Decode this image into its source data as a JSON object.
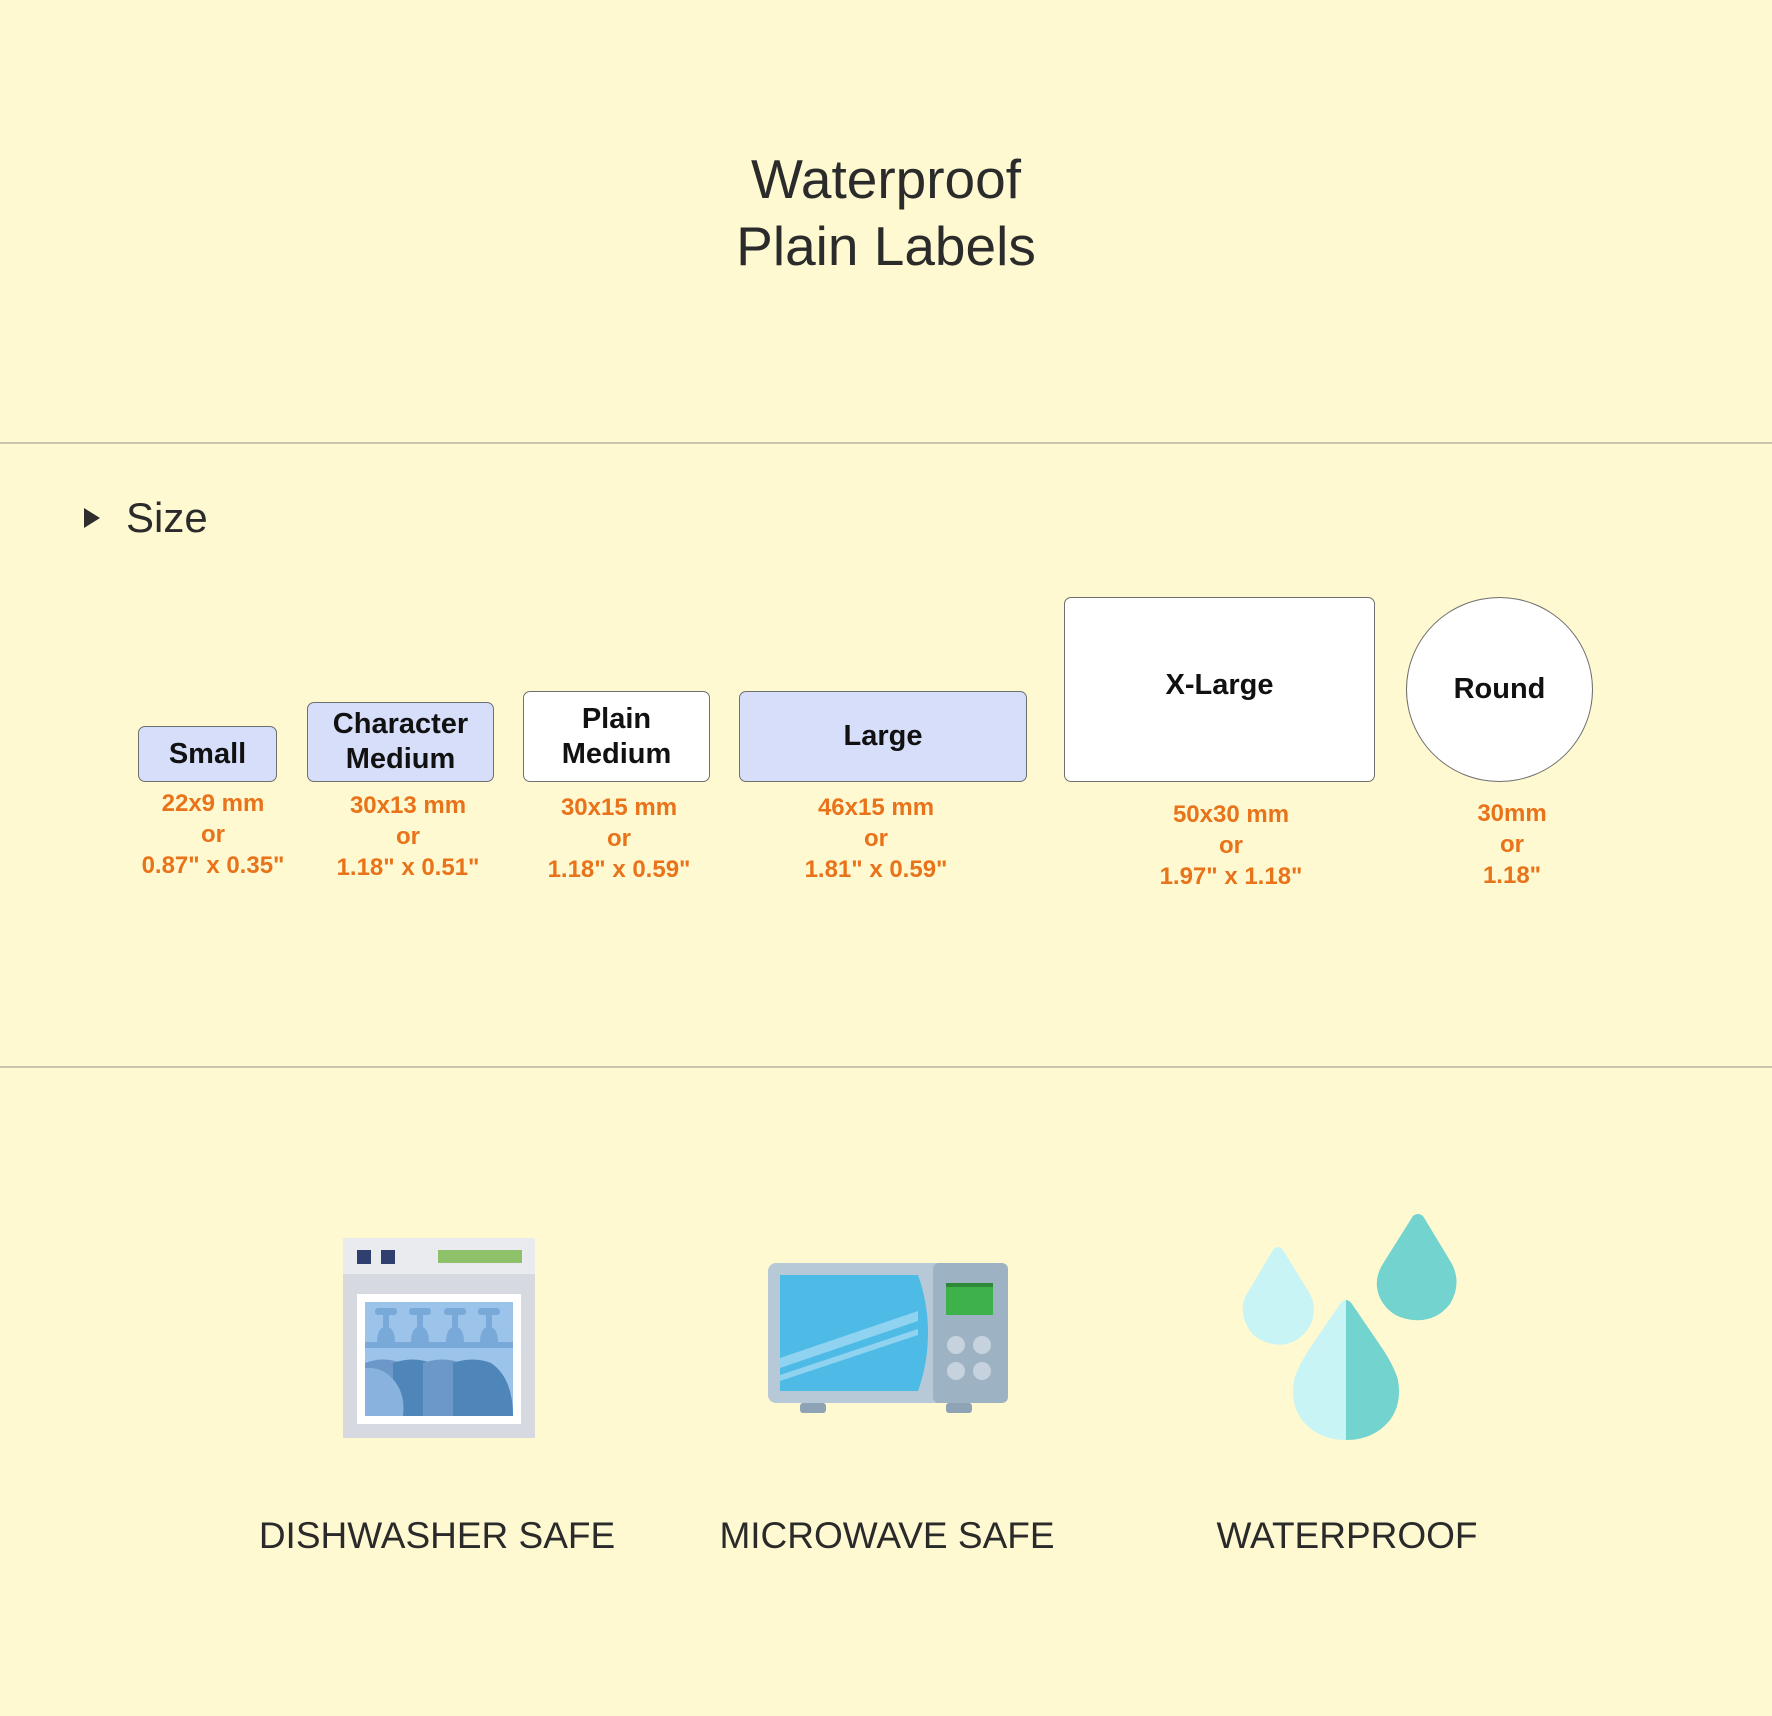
{
  "header": {
    "title_line1": "Waterproof",
    "title_line2": "Plain Labels"
  },
  "size_section": {
    "heading": "Size",
    "toggle_icon": "triangle-right-icon",
    "labels": [
      {
        "name": "Small",
        "line1": "Small",
        "line2": "",
        "metric": "22x9 mm",
        "or": "or",
        "imperial": "0.87\" x 0.35\"",
        "fill": "#d6defa"
      },
      {
        "name": "Character Medium",
        "line1": "Character",
        "line2": "Medium",
        "metric": "30x13 mm",
        "or": "or",
        "imperial": "1.18\" x 0.51\"",
        "fill": "#d6defa"
      },
      {
        "name": "Plain Medium",
        "line1": "Plain",
        "line2": "Medium",
        "metric": "30x15 mm",
        "or": "or",
        "imperial": "1.18\" x 0.59\"",
        "fill": "#ffffff"
      },
      {
        "name": "Large",
        "line1": "Large",
        "line2": "",
        "metric": "46x15 mm",
        "or": "or",
        "imperial": "1.81\" x 0.59\"",
        "fill": "#d6defa"
      },
      {
        "name": "X-Large",
        "line1": "X-Large",
        "line2": "",
        "metric": "50x30 mm",
        "or": "or",
        "imperial": "1.97\" x 1.18\"",
        "fill": "#ffffff"
      },
      {
        "name": "Round",
        "line1": "Round",
        "line2": "",
        "metric": "30mm",
        "or": "or",
        "imperial": "1.18\"",
        "fill": "#ffffff"
      }
    ]
  },
  "features": [
    {
      "icon": "dishwasher-icon",
      "label": "DISHWASHER SAFE"
    },
    {
      "icon": "microwave-icon",
      "label": "MICROWAVE SAFE"
    },
    {
      "icon": "water-drops-icon",
      "label": "WATERPROOF"
    }
  ],
  "colors": {
    "background": "#fef9d0",
    "dimension_text": "#e8731a",
    "label_blue": "#d6defa"
  }
}
